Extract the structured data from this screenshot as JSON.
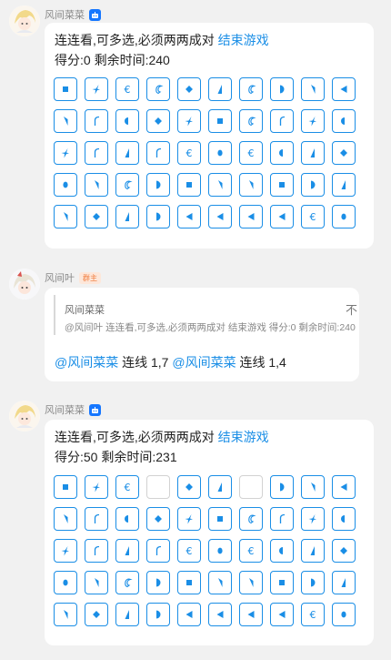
{
  "colors": {
    "tile_border": "#1a8ee6",
    "link": "#1a8ee6",
    "bot_badge": "#1677ff",
    "role_badge_text": "#f07a3a",
    "role_badge_bg": "#fde7da",
    "background": "#f1f1f1"
  },
  "messages": [
    {
      "sender": "风间菜菜",
      "sender_badge": "bot-icon",
      "line1_text": "连连看,可多选,必须两两成对",
      "line1_link": "结束游戏",
      "line2_text": "得分:0 剩余时间:240",
      "board": [
        [
          "square",
          "spark",
          "epsilon",
          "c-hook",
          "diamond",
          "wedge-up",
          "c-hook",
          "half-circle",
          "wedge-down",
          "wedge-left"
        ],
        [
          "wedge-down",
          "arch",
          "half-oval",
          "diamond",
          "spark",
          "square",
          "c-hook",
          "arch",
          "spark",
          "half-oval"
        ],
        [
          "spark",
          "arch",
          "wedge-up",
          "arch",
          "epsilon",
          "dot",
          "epsilon",
          "half-oval",
          "wedge-up",
          "diamond"
        ],
        [
          "dot",
          "wedge-down",
          "c-hook",
          "half-circle",
          "square",
          "wedge-down",
          "wedge-down",
          "square",
          "half-circle",
          "wedge-up"
        ],
        [
          "wedge-down",
          "diamond",
          "wedge-up",
          "half-circle",
          "wedge-left",
          "wedge-left",
          "wedge-left",
          "wedge-left",
          "epsilon",
          "dot"
        ]
      ]
    },
    {
      "sender": "风间叶",
      "sender_badge_text": "群主",
      "quote_sender": "风间菜菜",
      "quote_text": "@风间叶 连连看,可多选,必须两两成对 结束游戏 得分:0 剩余时间:240",
      "quote_close": "不",
      "reply_parts": [
        {
          "type": "mention",
          "text": "@风间菜菜"
        },
        {
          "type": "text",
          "text": " 连线 1,7 "
        },
        {
          "type": "mention",
          "text": "@风间菜菜"
        },
        {
          "type": "text",
          "text": " 连线 1,4"
        }
      ]
    },
    {
      "sender": "风间菜菜",
      "sender_badge": "bot-icon",
      "line1_text": "连连看,可多选,必须两两成对",
      "line1_link": "结束游戏",
      "line2_text": "得分:50 剩余时间:231",
      "board": [
        [
          "square",
          "spark",
          "epsilon",
          "empty",
          "diamond",
          "wedge-up",
          "empty",
          "half-circle",
          "wedge-down",
          "wedge-left"
        ],
        [
          "wedge-down",
          "arch",
          "half-oval",
          "diamond",
          "spark",
          "square",
          "c-hook",
          "arch",
          "spark",
          "half-oval"
        ],
        [
          "spark",
          "arch",
          "wedge-up",
          "arch",
          "epsilon",
          "dot",
          "epsilon",
          "half-oval",
          "wedge-up",
          "diamond"
        ],
        [
          "dot",
          "wedge-down",
          "c-hook",
          "half-circle",
          "square",
          "wedge-down",
          "wedge-down",
          "square",
          "half-circle",
          "wedge-up"
        ],
        [
          "wedge-down",
          "diamond",
          "wedge-up",
          "half-circle",
          "wedge-left",
          "wedge-left",
          "wedge-left",
          "wedge-left",
          "epsilon",
          "dot"
        ]
      ]
    }
  ]
}
